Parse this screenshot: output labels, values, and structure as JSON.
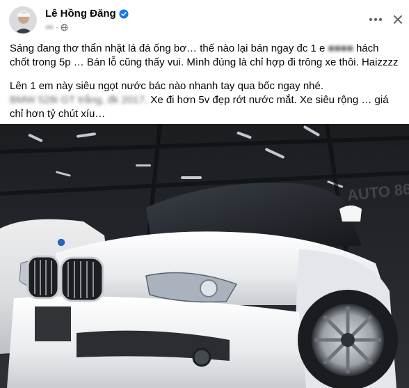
{
  "post": {
    "author": "Lê Hồng Đăng",
    "meta": "·",
    "paragraph1_a": "Sáng đang thơ thẩn nhặt lá đá ống bơ… thế nào lại bán ngay đc 1 e",
    "paragraph1_b": "chốt trong 5p … Bán lỗ cũng thấy vui. Mình đúng là chỉ hợp đi trông xe thôi. Haizzzz",
    "paragraph2_a": "Lên 1 em này siêu ngọt nước bác nào nhanh tay qua bốc ngay nhé.",
    "paragraph2_b": "Xe đi hơn 5v đẹp rớt nước mắt. Xe siêu rộng … giá chỉ hơn tỷ chút xíu…"
  },
  "photo": {
    "watermark": "AUTO 86"
  },
  "colors": {
    "verified": "#1877f2",
    "secondary_text": "#65676b",
    "car_body": "#eef0f2",
    "showroom_floor": "#2b2e33"
  },
  "icons": [
    "verified-badge-icon",
    "globe-icon",
    "more-options-icon",
    "close-icon"
  ]
}
